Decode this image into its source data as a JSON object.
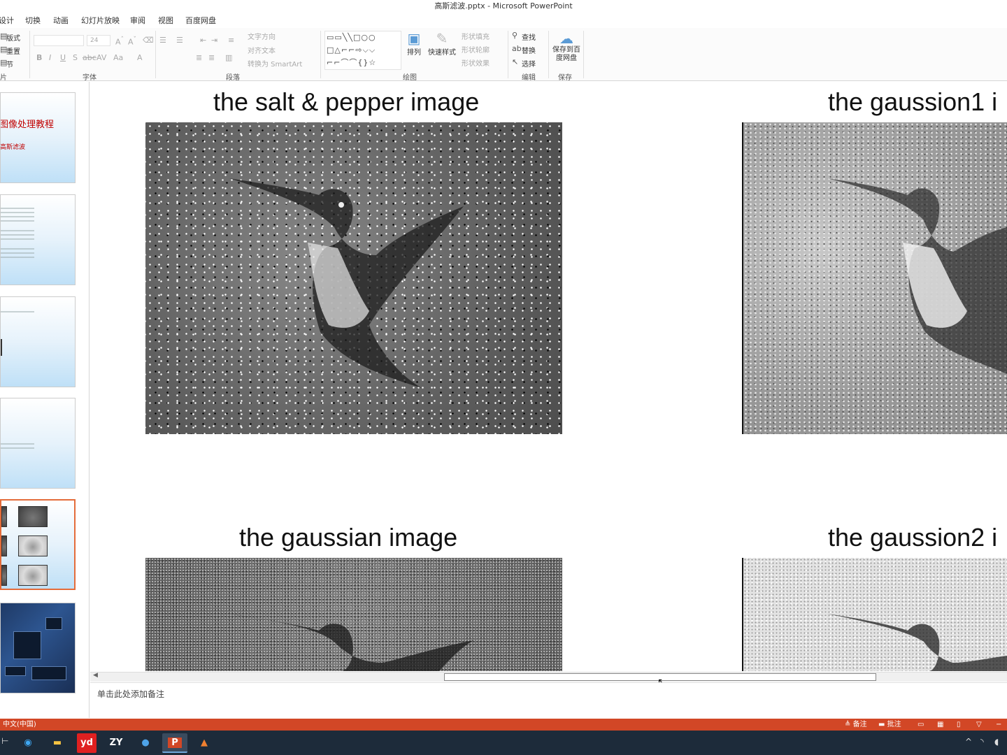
{
  "window": {
    "title": "高斯滤波.pptx - Microsoft PowerPoint"
  },
  "tabs": [
    "设计",
    "切换",
    "动画",
    "幻灯片放映",
    "审阅",
    "视图",
    "百度网盘"
  ],
  "ribbon": {
    "slides_group": {
      "layout": "版式",
      "reset": "重置",
      "section": "节",
      "label": "幻灯片"
    },
    "font_group": {
      "font_name": "",
      "font_size": "24",
      "label": "字体"
    },
    "paragraph_group": {
      "text_direction": "文字方向",
      "align_text": "对齐文本",
      "smartart": "转换为 SmartArt",
      "label": "段落"
    },
    "drawing_group": {
      "arrange": "排列",
      "quick_styles": "快速样式",
      "shape_fill": "形状填充",
      "shape_outline": "形状轮廓",
      "shape_effects": "形状效果",
      "label": "绘图"
    },
    "editing_group": {
      "find": "查找",
      "replace": "替换",
      "select": "选择",
      "label": "编辑"
    },
    "save_group": {
      "save_to_baidu": "保存到百度网盘",
      "label": "保存"
    }
  },
  "thumbnails": [
    {
      "title": "图像处理教程",
      "subtitle": "高斯滤波"
    },
    {
      "title": "",
      "subtitle": ""
    },
    {
      "title": "",
      "subtitle": ""
    },
    {
      "title": "",
      "subtitle": ""
    },
    {
      "title": "",
      "subtitle": "",
      "selected": true
    },
    {
      "title": "",
      "subtitle": ""
    }
  ],
  "slide": {
    "titles": {
      "top_left": "the salt & pepper image",
      "top_right": "the gaussion1 i",
      "bottom_left": "the gaussian image",
      "bottom_right": "the gaussion2 i"
    }
  },
  "notes": {
    "placeholder": "单击此处添加备注"
  },
  "status": {
    "language": "中文(中国)",
    "notes": "备注",
    "comments": "批注"
  },
  "taskbar": {
    "apps": [
      "edge-icon",
      "file-explorer-icon",
      "youdao-icon",
      "zy-icon",
      "app-icon",
      "powerpoint-icon",
      "matlab-icon"
    ]
  }
}
